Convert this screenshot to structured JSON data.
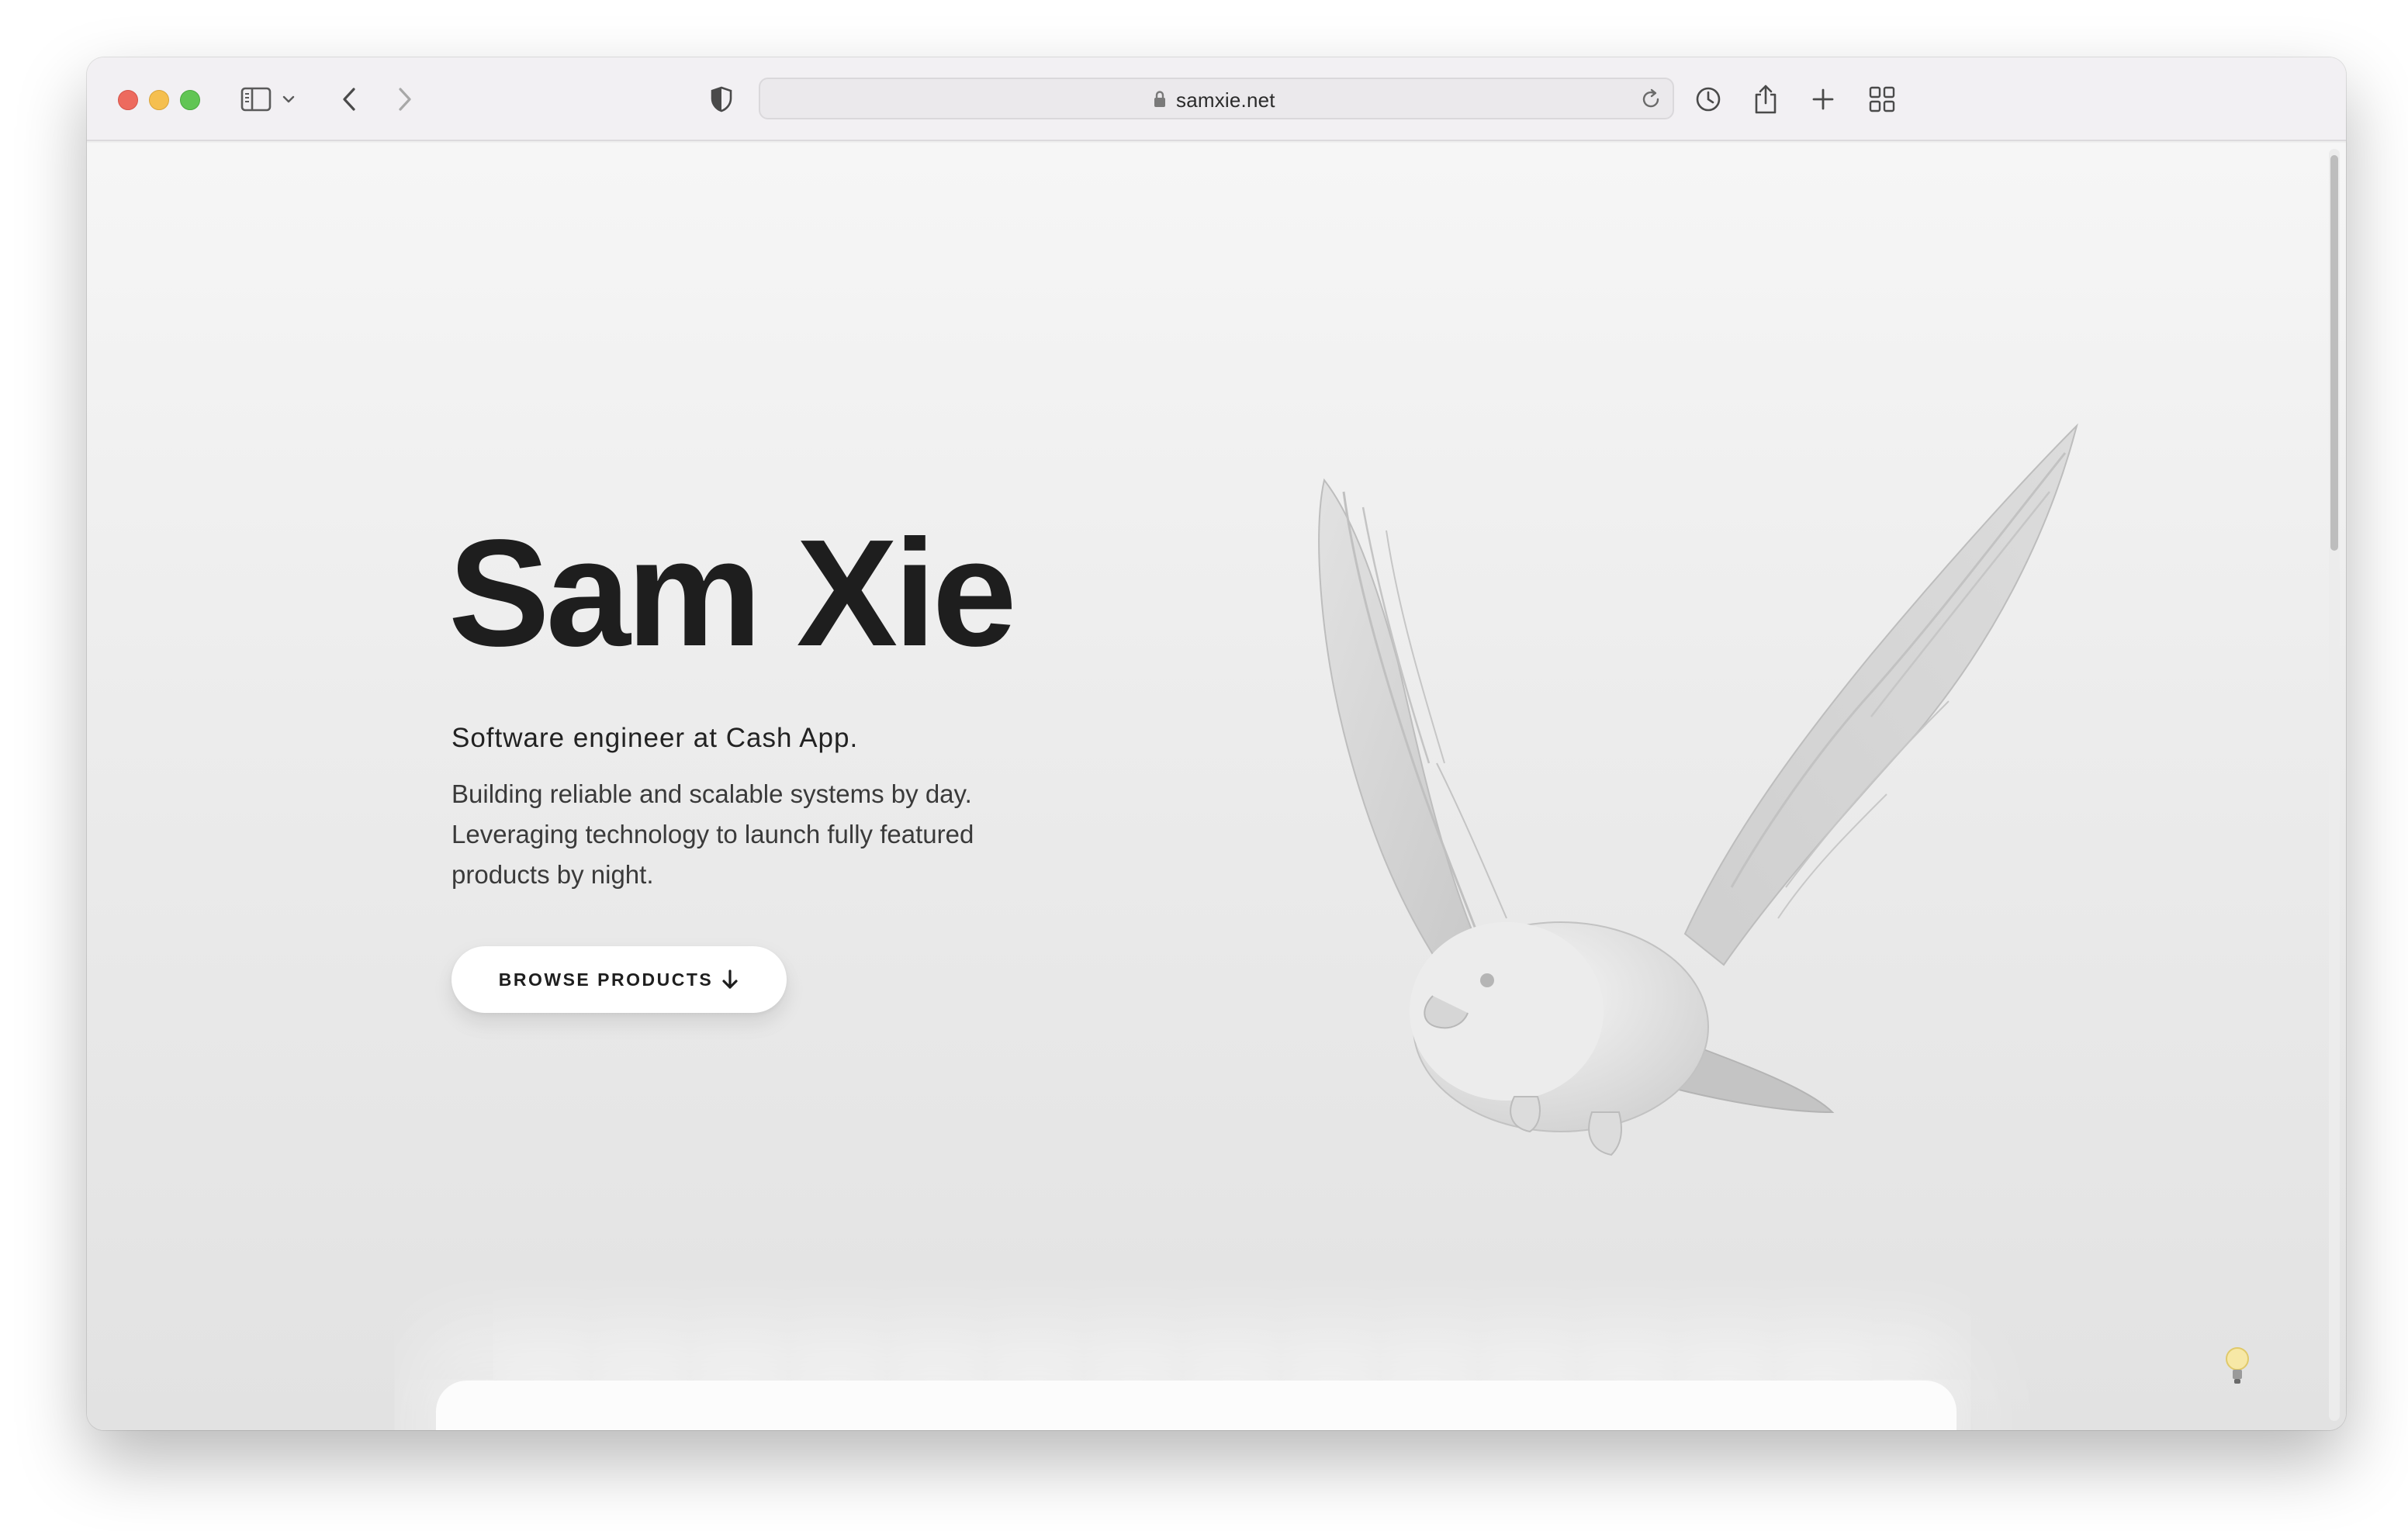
{
  "browser": {
    "url": "samxie.net",
    "icons": [
      "sidebar-icon",
      "chevron-down-icon",
      "back-arrow-icon",
      "forward-arrow-icon",
      "shield-icon",
      "lock-icon",
      "reload-icon",
      "history-icon",
      "share-icon",
      "plus-icon",
      "tab-grid-icon"
    ]
  },
  "hero": {
    "title": "Sam Xie",
    "subtitle": "Software engineer at Cash App.",
    "description": "Building reliable and scalable systems by day. Leveraging technology to launch fully featured products by night.",
    "cta_label": "BROWSE PRODUCTS"
  },
  "colors": {
    "title": "#1e1e1e",
    "page_background": "#ececec",
    "traffic_red": "#ed6a5e",
    "traffic_yellow": "#f5bf4f",
    "traffic_green": "#61c554"
  }
}
